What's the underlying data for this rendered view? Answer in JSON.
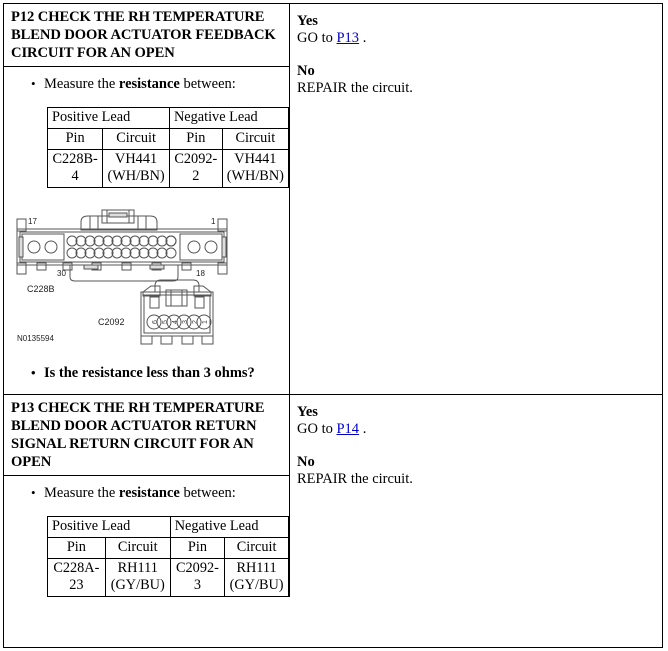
{
  "document": {
    "type": "automotive-diagnostic-pinpoint-test",
    "figure_id": "N0135594"
  },
  "steps": [
    {
      "id": "P12",
      "title": "P12 CHECK THE RH TEMPERATURE BLEND DOOR ACTUATOR FEEDBACK CIRCUIT FOR AN OPEN",
      "instruction_prefix": "Measure the ",
      "instruction_bold": "resistance",
      "instruction_suffix": " between:",
      "table": {
        "group_headers": [
          "Positive Lead",
          "Negative Lead"
        ],
        "group_header_left": "Positive Lead",
        "group_header_right": "Negative Lead",
        "sub_headers": [
          "Pin",
          "Circuit",
          "Pin",
          "Circuit"
        ],
        "rows": [
          {
            "positive_pin": "C228B-4",
            "positive_circuit": "VH441 (WH/BN)",
            "negative_pin": "C2092-2",
            "negative_circuit": "VH441 (WH/BN)"
          }
        ]
      },
      "question": "Is the resistance less than 3 ohms?",
      "figure": {
        "id": "N0135594",
        "connectors": [
          {
            "name": "C228B",
            "pin_labels": [
              "17",
              "1",
              "30",
              "18"
            ],
            "type": "multi-pin-rectangular"
          },
          {
            "name": "C2092",
            "pin_labels": [
              "6",
              "5",
              "4",
              "3",
              "2",
              "1"
            ],
            "type": "six-pin"
          }
        ]
      },
      "answers": [
        {
          "label": "Yes",
          "text_prefix": "GO to ",
          "link": "P13",
          "text_suffix": " ."
        },
        {
          "label": "No",
          "text_prefix": "REPAIR the circuit.",
          "link": "",
          "text_suffix": ""
        }
      ]
    },
    {
      "id": "P13",
      "title": "P13 CHECK THE RH TEMPERATURE BLEND DOOR ACTUATOR RETURN SIGNAL RETURN CIRCUIT FOR AN OPEN",
      "instruction_prefix": "Measure the ",
      "instruction_bold": "resistance",
      "instruction_suffix": " between:",
      "table": {
        "group_header_left": "Positive Lead",
        "group_header_right": "Negative Lead",
        "sub_headers": [
          "Pin",
          "Circuit",
          "Pin",
          "Circuit"
        ],
        "rows": [
          {
            "positive_pin": "C228A-23",
            "positive_circuit": "RH111 (GY/BU)",
            "negative_pin": "C2092-3",
            "negative_circuit": "RH111 (GY/BU)"
          }
        ]
      },
      "answers": [
        {
          "label": "Yes",
          "text_prefix": "GO to ",
          "link": "P14",
          "text_suffix": " ."
        },
        {
          "label": "No",
          "text_prefix": "REPAIR the circuit.",
          "link": "",
          "text_suffix": ""
        }
      ]
    }
  ],
  "colors": {
    "link": "#0000cc",
    "border": "#000000",
    "text": "#000000",
    "figure_line": "#4d4d4d"
  }
}
